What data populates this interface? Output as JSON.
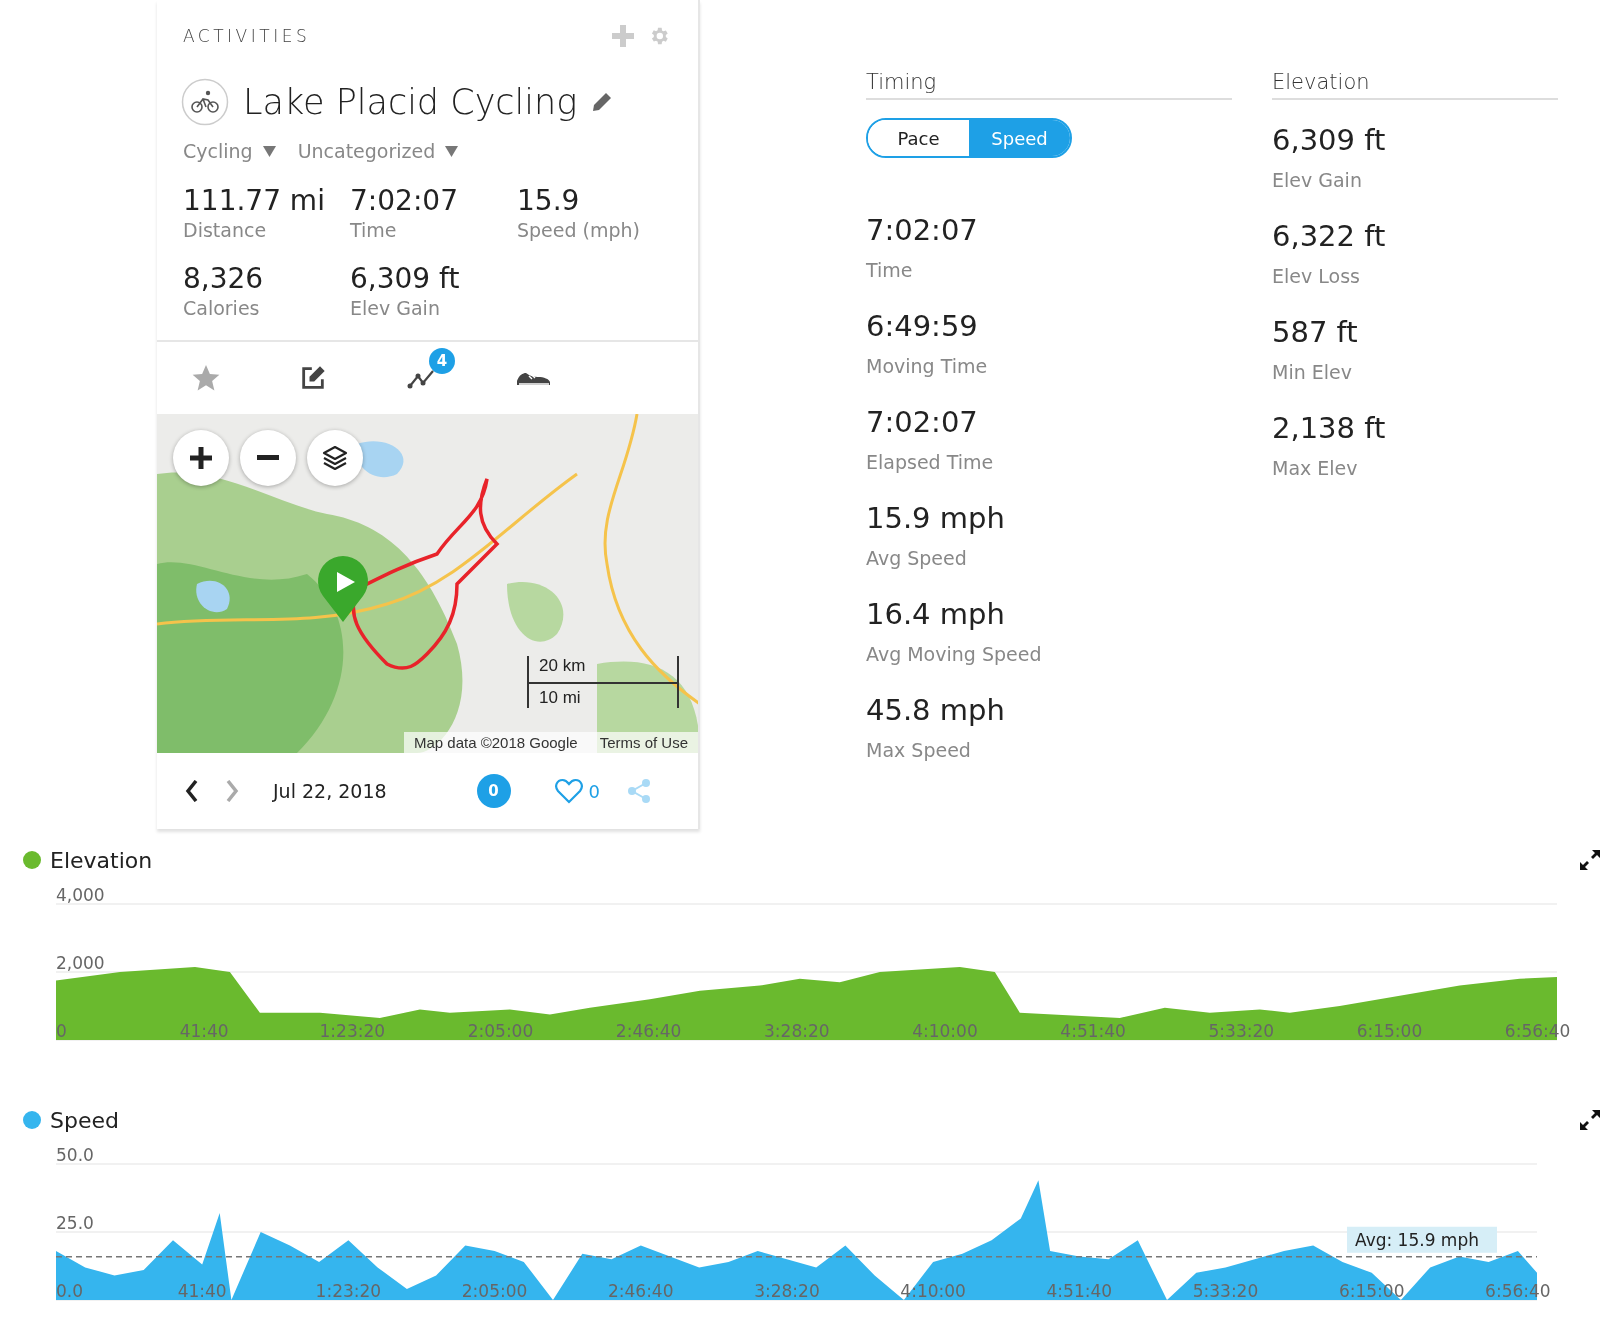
{
  "sidebar": {
    "section_title": "ACTIVITIES",
    "title": "Lake Placid Cycling",
    "type": "Cycling",
    "category": "Uncategorized",
    "stats": [
      {
        "value": "111.77 mi",
        "label": "Distance"
      },
      {
        "value": "7:02:07",
        "label": "Time"
      },
      {
        "value": "15.9",
        "label": "Speed (mph)"
      },
      {
        "value": "8,326",
        "label": "Calories"
      },
      {
        "value": "6,309 ft",
        "label": "Elev Gain"
      }
    ],
    "tabs": [
      {
        "kind": "star"
      },
      {
        "kind": "notes"
      },
      {
        "kind": "route",
        "badge": "4"
      },
      {
        "kind": "gear"
      }
    ],
    "map": {
      "scale_metric": "20 km",
      "scale_imperial": "10 mi",
      "attribution": "Map data ©2018 Google",
      "terms": "Terms of Use"
    },
    "date": "Jul 22, 2018",
    "comments": "0",
    "likes": "0"
  },
  "timing": {
    "title": "Timing",
    "toggle": [
      {
        "label": "Pace",
        "selected": false
      },
      {
        "label": "Speed",
        "selected": true
      }
    ],
    "stats": [
      {
        "value": "7:02:07",
        "label": "Time"
      },
      {
        "value": "6:49:59",
        "label": "Moving Time"
      },
      {
        "value": "7:02:07",
        "label": "Elapsed Time"
      },
      {
        "value": "15.9 mph",
        "label": "Avg Speed"
      },
      {
        "value": "16.4 mph",
        "label": "Avg Moving Speed"
      },
      {
        "value": "45.8 mph",
        "label": "Max Speed"
      }
    ]
  },
  "elevation": {
    "title": "Elevation",
    "stats": [
      {
        "value": "6,309 ft",
        "label": "Elev Gain"
      },
      {
        "value": "6,322 ft",
        "label": "Elev Loss"
      },
      {
        "value": "587 ft",
        "label": "Min Elev"
      },
      {
        "value": "2,138 ft",
        "label": "Max Elev"
      }
    ]
  },
  "charts": [
    {
      "chart_data": {
        "type": "area",
        "xlim": [
          0,
          25327
        ],
        "ylim": [
          0,
          4000
        ],
        "x": [
          0,
          1080,
          2345,
          2935,
          3441,
          4454,
          5466,
          6141,
          6647,
          7659,
          8334,
          9009,
          10021,
          10864,
          11876,
          12551,
          13226,
          13901,
          15251,
          15841,
          16263,
          17950,
          18709,
          19468,
          20312,
          20818,
          21661,
          22673,
          23685,
          24697,
          25327
        ],
        "series": [
          {
            "name": "Elevation",
            "color": "#6aba2e",
            "values": [
              1750,
              2000,
              2150,
              2000,
              800,
              800,
              650,
              900,
              800,
              900,
              750,
              950,
              1200,
              1450,
              1600,
              1800,
              1700,
              2000,
              2150,
              2000,
              800,
              650,
              950,
              800,
              900,
              800,
              1000,
              1300,
              1600,
              1800,
              1850
            ]
          }
        ],
        "yticks": [
          {
            "value": 0,
            "label": "0"
          },
          {
            "value": 2000,
            "label": "2,000"
          },
          {
            "value": 4000,
            "label": "4,000"
          }
        ],
        "xticks": [
          {
            "value": 2500,
            "label": "41:40"
          },
          {
            "value": 5000,
            "label": "1:23:20"
          },
          {
            "value": 7500,
            "label": "2:05:00"
          },
          {
            "value": 10000,
            "label": "2:46:40"
          },
          {
            "value": 12500,
            "label": "3:28:20"
          },
          {
            "value": 15000,
            "label": "4:10:00"
          },
          {
            "value": 17500,
            "label": "4:51:40"
          },
          {
            "value": 20000,
            "label": "5:33:20"
          },
          {
            "value": 22500,
            "label": "6:15:00"
          },
          {
            "value": 25000,
            "label": "6:56:40"
          }
        ]
      }
    },
    {
      "chart_data": {
        "type": "area",
        "xlim": [
          0,
          25327
        ],
        "ylim": [
          0,
          50
        ],
        "x": [
          0,
          500,
          1000,
          1500,
          2000,
          2500,
          2800,
          3000,
          3500,
          4000,
          4500,
          5000,
          5500,
          6000,
          6500,
          7000,
          7500,
          8000,
          8500,
          9000,
          9500,
          10000,
          10500,
          11000,
          11500,
          12000,
          12500,
          13000,
          13500,
          14000,
          14500,
          15000,
          15500,
          16000,
          16500,
          16800,
          17000,
          17500,
          18000,
          18500,
          19000,
          19500,
          20000,
          20500,
          21000,
          21500,
          22000,
          22500,
          23000,
          23500,
          24000,
          24500,
          25000,
          25327
        ],
        "series": [
          {
            "name": "Speed",
            "color": "#35b5ee",
            "values": [
              18,
              12,
              9,
              11,
              22,
              13,
              32,
              0,
              25,
              20,
              14,
              22,
              12,
              4,
              9,
              20,
              18,
              14,
              0,
              17,
              15,
              20,
              16,
              12,
              14,
              18,
              15,
              12,
              20,
              9,
              0,
              14,
              17,
              22,
              30,
              44,
              18,
              16,
              15,
              22,
              0,
              10,
              12,
              15,
              18,
              20,
              14,
              10,
              0,
              12,
              16,
              14,
              18,
              10
            ]
          }
        ],
        "yticks": [
          {
            "value": 0,
            "label": "0.0"
          },
          {
            "value": 25,
            "label": "25.0"
          },
          {
            "value": 50,
            "label": "50.0"
          }
        ],
        "xticks": [
          {
            "value": 2500,
            "label": "41:40"
          },
          {
            "value": 5000,
            "label": "1:23:20"
          },
          {
            "value": 7500,
            "label": "2:05:00"
          },
          {
            "value": 10000,
            "label": "2:46:40"
          },
          {
            "value": 12500,
            "label": "3:28:20"
          },
          {
            "value": 15000,
            "label": "4:10:00"
          },
          {
            "value": 17500,
            "label": "4:51:40"
          },
          {
            "value": 20000,
            "label": "5:33:20"
          },
          {
            "value": 22500,
            "label": "6:15:00"
          },
          {
            "value": 25000,
            "label": "6:56:40"
          }
        ],
        "ref_lines": [
          {
            "axis": "y",
            "value": 15.9,
            "label": "Avg: 15.9 mph"
          }
        ]
      }
    }
  ]
}
